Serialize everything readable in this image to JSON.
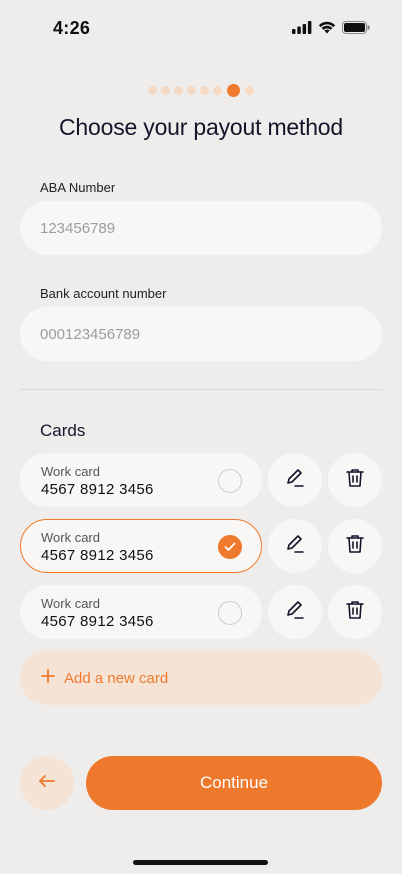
{
  "status_bar": {
    "time": "4:26"
  },
  "progress": {
    "total": 7,
    "current": 6
  },
  "title": "Choose your payout method",
  "aba": {
    "label": "ABA Number",
    "placeholder": "123456789"
  },
  "bank_account": {
    "label": "Bank account number",
    "placeholder": "000123456789"
  },
  "cards_section": {
    "title": "Cards",
    "cards": [
      {
        "name": "Work card",
        "number": "4567 8912 3456",
        "selected": false
      },
      {
        "name": "Work card",
        "number": "4567 8912 3456",
        "selected": true
      },
      {
        "name": "Work card",
        "number": "4567 8912 3456",
        "selected": false
      }
    ],
    "add_label": "Add a new card"
  },
  "footer": {
    "continue_label": "Continue"
  },
  "colors": {
    "accent": "#ee792c",
    "accent_light": "#f5e3d6",
    "background": "#efedeb",
    "field": "#f8f7f6"
  },
  "icons": [
    "signal-icon",
    "wifi-icon",
    "battery-icon",
    "pencil-icon",
    "trash-icon",
    "check-icon",
    "plus-icon",
    "arrow-left-icon"
  ]
}
